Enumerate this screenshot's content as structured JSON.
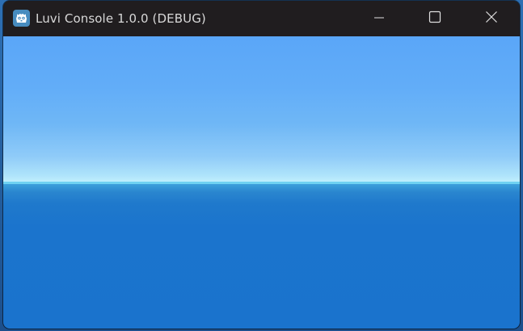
{
  "window": {
    "title": "Luvi Console 1.0.0 (DEBUG)",
    "app_icon": "godot-icon",
    "controls": {
      "minimize": "minimize-icon",
      "maximize": "maximize-icon",
      "close": "close-icon"
    }
  },
  "scene": {
    "sky_color": "#62adf8",
    "horizon_color": "#c2f0fd",
    "ground_color": "#1a73cd"
  }
}
